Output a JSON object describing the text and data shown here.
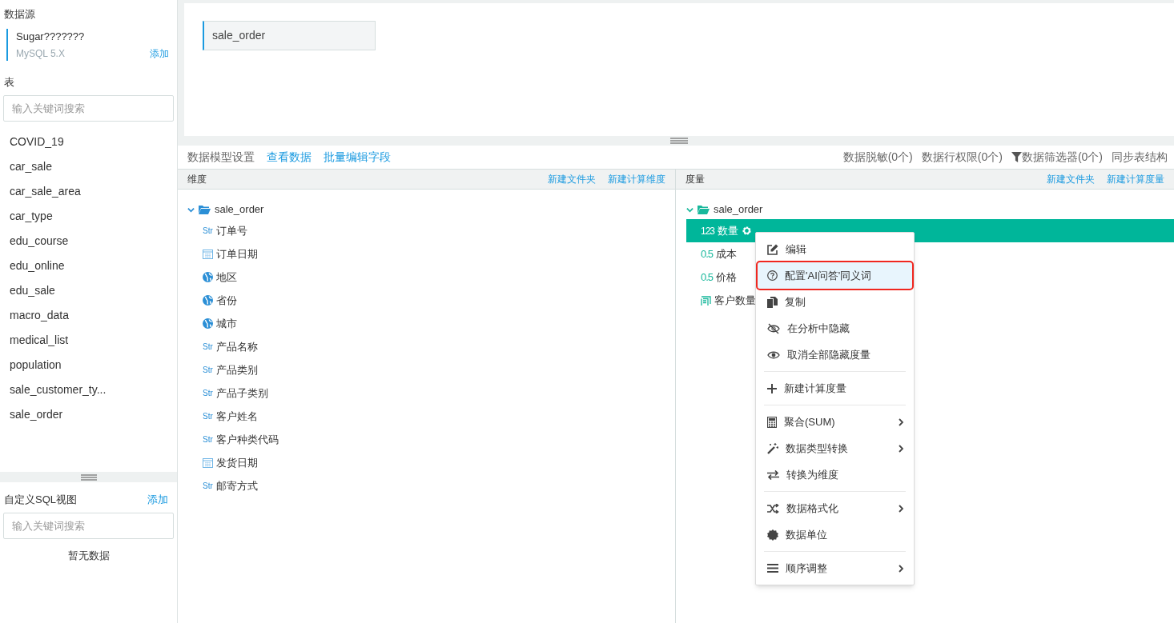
{
  "sidebar": {
    "datasource_heading": "数据源",
    "datasource": {
      "name": "Sugar???????",
      "type": "MySQL 5.X",
      "add": "添加"
    },
    "tables_heading": "表",
    "table_search": {
      "placeholder": "输入关键词搜索"
    },
    "tables": [
      {
        "name": "COVID_19"
      },
      {
        "name": "car_sale"
      },
      {
        "name": "car_sale_area"
      },
      {
        "name": "car_type"
      },
      {
        "name": "edu_course"
      },
      {
        "name": "edu_online"
      },
      {
        "name": "edu_sale"
      },
      {
        "name": "macro_data"
      },
      {
        "name": "medical_list"
      },
      {
        "name": "population"
      },
      {
        "name": "sale_customer_ty..."
      },
      {
        "name": "sale_order"
      }
    ],
    "sql_heading": "自定义SQL视图",
    "sql_add": "添加",
    "sql_search": {
      "placeholder": "输入关键词搜索"
    },
    "sql_empty": "暂无数据"
  },
  "canvas": {
    "tables": [
      {
        "name": "sale_order"
      }
    ]
  },
  "toolbar": {
    "title": "数据模型设置",
    "links": [
      "查看数据",
      "批量编辑字段"
    ],
    "right": [
      {
        "kind": "text",
        "label": "数据脱敏(0个)"
      },
      {
        "kind": "text",
        "label": "数据行权限(0个)"
      },
      {
        "kind": "filter",
        "label": "数据筛选器(0个)"
      },
      {
        "kind": "text",
        "label": "同步表结构"
      }
    ]
  },
  "dimensions": {
    "title": "维度",
    "actions": [
      "新建文件夹",
      "新建计算维度"
    ],
    "folder": {
      "name": "sale_order",
      "expanded": true
    },
    "fields": [
      {
        "kind": "str",
        "type_label": "Str",
        "name": "订单号"
      },
      {
        "kind": "date",
        "name": "订单日期"
      },
      {
        "kind": "geo",
        "name": "地区"
      },
      {
        "kind": "geo",
        "name": "省份"
      },
      {
        "kind": "geo",
        "name": "城市"
      },
      {
        "kind": "str",
        "type_label": "Str",
        "name": "产品名称"
      },
      {
        "kind": "str",
        "type_label": "Str",
        "name": "产品类别"
      },
      {
        "kind": "str",
        "type_label": "Str",
        "name": "产品子类别"
      },
      {
        "kind": "str",
        "type_label": "Str",
        "name": "客户姓名"
      },
      {
        "kind": "str",
        "type_label": "Str",
        "name": "客户种类代码"
      },
      {
        "kind": "date",
        "name": "发货日期"
      },
      {
        "kind": "str",
        "type_label": "Str",
        "name": "邮寄方式"
      }
    ]
  },
  "measures": {
    "title": "度量",
    "actions": [
      "新建文件夹",
      "新建计算度量"
    ],
    "folder": {
      "name": "sale_order",
      "expanded": true
    },
    "fields": [
      {
        "kind": "number",
        "type_label": "123",
        "name": "数量",
        "selected": true
      },
      {
        "kind": "number",
        "type_label": "0.5",
        "name": "成本",
        "selected": false
      },
      {
        "kind": "number",
        "type_label": "0.5",
        "name": "价格",
        "selected": false
      },
      {
        "kind": "count",
        "name": "客户数量",
        "selected": false
      }
    ]
  },
  "context_menu": {
    "groups": [
      [
        {
          "label": "编辑",
          "submenu": false,
          "highlighted": false
        },
        {
          "label": "配置'AI问答'同义词",
          "submenu": false,
          "highlighted": true
        },
        {
          "label": "复制",
          "submenu": false,
          "highlighted": false
        },
        {
          "label": "在分析中隐藏",
          "submenu": false,
          "highlighted": false
        },
        {
          "label": "取消全部隐藏度量",
          "submenu": false,
          "highlighted": false
        }
      ],
      [
        {
          "label": "新建计算度量",
          "submenu": false,
          "highlighted": false
        }
      ],
      [
        {
          "label": "聚合(SUM)",
          "submenu": true,
          "highlighted": false
        },
        {
          "label": "数据类型转换",
          "submenu": true,
          "highlighted": false
        },
        {
          "label": "转换为维度",
          "submenu": false,
          "highlighted": false
        }
      ],
      [
        {
          "label": "数据格式化",
          "submenu": true,
          "highlighted": false
        },
        {
          "label": "数据单位",
          "submenu": false,
          "highlighted": false
        }
      ],
      [
        {
          "label": "顺序调整",
          "submenu": true,
          "highlighted": false
        }
      ]
    ]
  }
}
